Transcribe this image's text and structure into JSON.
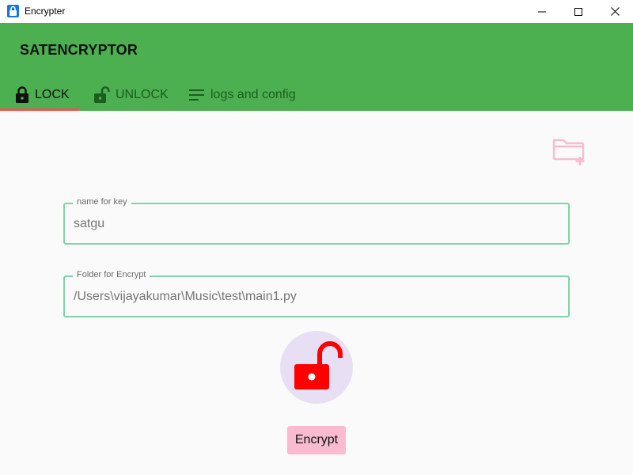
{
  "window": {
    "title": "Encrypter",
    "icon": "app-lock-icon",
    "controls": [
      "minimize-icon",
      "maximize-icon",
      "close-icon"
    ]
  },
  "appbar": {
    "name": "SATENCRYPTOR",
    "color": "#4caf50"
  },
  "tabs": [
    {
      "label": "LOCK",
      "icon": "lock-icon",
      "selected": true
    },
    {
      "label": "UNLOCK",
      "icon": "lock-open-icon",
      "selected": false
    },
    {
      "label": "logs and config",
      "icon": "menu-lines-icon",
      "selected": false
    }
  ],
  "tab_indicator_color": "#ef5350",
  "toolbar": {
    "folder_action_icon": "folder-add-icon"
  },
  "form": {
    "key_field": {
      "label": "name for key",
      "value": "satgu"
    },
    "folder_field": {
      "label": "Folder for Encrypt",
      "value": "/Users\\vijayakumar\\Music\\test\\main1.py"
    },
    "field_border_color": "#81d4a8"
  },
  "lock_button": {
    "icon": "lock-open-icon",
    "icon_color": "#ff0000",
    "background": "#e8dff4"
  },
  "encrypt_button": {
    "label": "Encrypt",
    "background": "#f8bbd0"
  }
}
